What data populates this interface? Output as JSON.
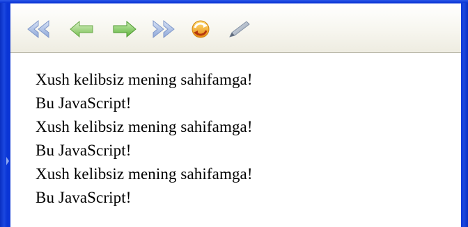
{
  "toolbar": {
    "buttons": [
      {
        "name": "first-page",
        "icon": "double-arrow-left-icon",
        "color": "#a9bde2"
      },
      {
        "name": "back",
        "icon": "arrow-left-icon",
        "color": "#8fcf6a"
      },
      {
        "name": "forward",
        "icon": "arrow-right-icon",
        "color": "#6cc24a"
      },
      {
        "name": "last-page",
        "icon": "double-arrow-right-icon",
        "color": "#a9bde2"
      },
      {
        "name": "refresh",
        "icon": "refresh-icon",
        "color": "#f5b81e"
      },
      {
        "name": "edit",
        "icon": "pencil-icon",
        "color": "#9aa7b7"
      }
    ]
  },
  "content": {
    "lines": [
      "Xush kelibsiz mening sahifamga!",
      "Bu JavaScript!",
      "Xush kelibsiz mening sahifamga!",
      "Bu JavaScript!",
      "Xush kelibsiz mening sahifamga!",
      "Bu JavaScript!"
    ]
  },
  "colors": {
    "frame": "#0a35d6",
    "toolbar_bg": "#f7f6ef",
    "content_bg": "#ffffff",
    "text": "#000000"
  }
}
